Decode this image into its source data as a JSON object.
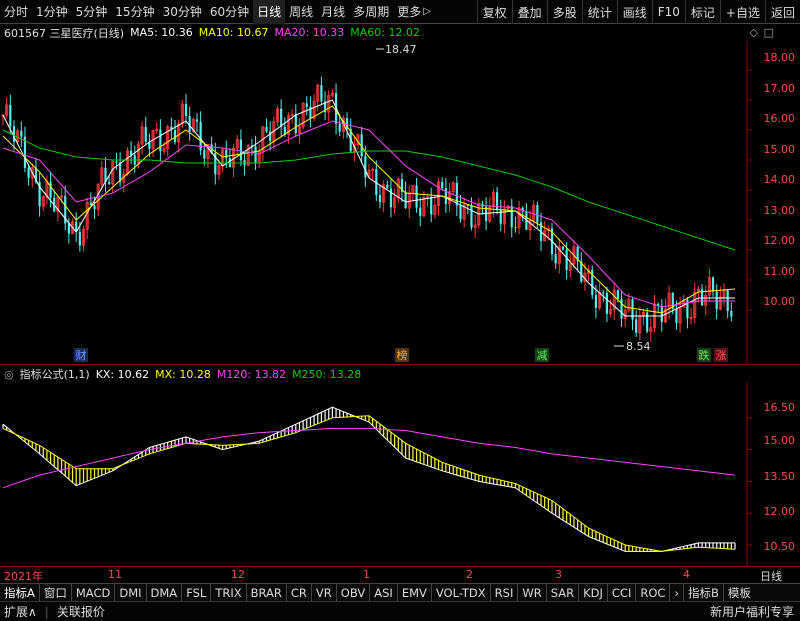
{
  "toolbar": {
    "periods": [
      "分时",
      "1分钟",
      "5分钟",
      "15分钟",
      "30分钟",
      "60分钟",
      "日线",
      "周线",
      "月线",
      "多周期",
      "更多"
    ],
    "more_arrow": "▷",
    "active_period": "日线",
    "actions": [
      "复权",
      "叠加",
      "多股",
      "统计",
      "画线",
      "F10",
      "标记",
      "+自选",
      "返回"
    ]
  },
  "main": {
    "stock": "601567 三星医疗(日线)",
    "ma5": "MA5: 10.36",
    "ma10": "MA10: 10.67",
    "ma20": "MA20: 10.33",
    "ma60": "MA60: 12.02",
    "high_marker": "18.47",
    "low_marker": "8.54",
    "y_ticks": [
      "18.00",
      "17.00",
      "16.00",
      "15.00",
      "14.00",
      "13.00",
      "12.00",
      "11.00",
      "10.00"
    ],
    "event_tags": [
      "财",
      "榜",
      "减",
      "跌",
      "涨"
    ]
  },
  "sub": {
    "title": "指标公式(1,1)",
    "kx": "KX: 10.62",
    "mx": "MX: 10.28",
    "m120": "M120: 13.82",
    "m250": "M250: 13.28",
    "y_ticks": [
      "16.50",
      "15.00",
      "13.50",
      "12.00",
      "10.50"
    ]
  },
  "dates": {
    "labels": [
      "2021年",
      "11",
      "12",
      "1",
      "2",
      "3",
      "4"
    ],
    "right": "日线"
  },
  "tabs": [
    "指标A",
    "窗口",
    "MACD",
    "DMI",
    "DMA",
    "FSL",
    "TRIX",
    "BRAR",
    "CR",
    "VR",
    "OBV",
    "ASI",
    "EMV",
    "VOL-TDX",
    "RSI",
    "WR",
    "SAR",
    "KDJ",
    "CCI",
    "ROC",
    "›",
    "指标B",
    "模板"
  ],
  "bottom": {
    "left": [
      "扩展∧",
      "关联报价"
    ],
    "right": "新用户福利专享"
  },
  "colors": {
    "up": "#ff3b3b",
    "down": "#54f0f0",
    "ma5": "#ffffff",
    "ma10": "#ffff00",
    "ma20": "#ff44ff",
    "ma60": "#00cc00",
    "axis": "#8b0000",
    "price": "#ff4a4a"
  },
  "chart_data": [
    {
      "type": "line",
      "title": "601567 三星医疗(日线)",
      "ylim": [
        8.3,
        18.9
      ],
      "series": [
        {
          "name": "MA5",
          "x": [
            0,
            10,
            20,
            30,
            40,
            50,
            60,
            70,
            80,
            90,
            100,
            110,
            120,
            130,
            140,
            150,
            160,
            170,
            180,
            190,
            200
          ],
          "values": [
            16.5,
            14.1,
            12.6,
            14.7,
            15.6,
            16.3,
            14.8,
            15.6,
            16.5,
            17.0,
            14.4,
            13.6,
            13.8,
            13.2,
            13.3,
            12.3,
            10.9,
            9.8,
            9.8,
            10.4,
            10.4
          ]
        },
        {
          "name": "MA10",
          "x": [
            0,
            10,
            20,
            30,
            40,
            50,
            60,
            70,
            80,
            90,
            100,
            110,
            120,
            130,
            140,
            150,
            160,
            170,
            180,
            190,
            200
          ],
          "values": [
            15.8,
            14.6,
            13.0,
            14.1,
            15.2,
            16.0,
            15.1,
            15.3,
            16.1,
            16.8,
            15.1,
            13.9,
            13.8,
            13.4,
            13.3,
            12.6,
            11.3,
            10.1,
            9.9,
            10.6,
            10.7
          ]
        },
        {
          "name": "MA20",
          "x": [
            0,
            10,
            20,
            30,
            40,
            50,
            60,
            70,
            80,
            90,
            100,
            110,
            120,
            130,
            140,
            150,
            160,
            170,
            180,
            190,
            200
          ],
          "values": [
            15.4,
            15.0,
            13.6,
            13.9,
            14.6,
            15.5,
            15.4,
            15.2,
            15.8,
            16.3,
            16.0,
            14.8,
            14.0,
            13.5,
            13.4,
            13.0,
            11.8,
            10.5,
            10.1,
            10.3,
            10.3
          ]
        },
        {
          "name": "MA60",
          "x": [
            0,
            10,
            20,
            30,
            40,
            50,
            60,
            70,
            80,
            90,
            100,
            110,
            120,
            130,
            140,
            150,
            160,
            170,
            180,
            190,
            200
          ],
          "values": [
            16.0,
            15.4,
            15.1,
            15.0,
            15.0,
            14.9,
            14.9,
            14.9,
            15.0,
            15.2,
            15.3,
            15.3,
            15.1,
            14.8,
            14.5,
            14.1,
            13.6,
            13.2,
            12.8,
            12.4,
            12.0
          ]
        }
      ]
    },
    {
      "type": "area",
      "title": "指标公式(1,1)",
      "ylim": [
        9.7,
        18.0
      ],
      "series": [
        {
          "name": "KX",
          "x": [
            0,
            10,
            20,
            30,
            40,
            50,
            60,
            70,
            80,
            90,
            100,
            110,
            120,
            130,
            140,
            150,
            160,
            170,
            180,
            190,
            200
          ],
          "values": [
            16.2,
            14.8,
            13.3,
            14.0,
            15.1,
            15.6,
            15.0,
            15.4,
            16.2,
            17.0,
            16.3,
            14.6,
            14.0,
            13.5,
            13.2,
            12.0,
            10.9,
            10.2,
            10.2,
            10.6,
            10.6
          ]
        },
        {
          "name": "MX",
          "x": [
            0,
            10,
            20,
            30,
            40,
            50,
            60,
            70,
            80,
            90,
            100,
            110,
            120,
            130,
            140,
            150,
            160,
            170,
            180,
            190,
            200
          ],
          "values": [
            16.0,
            15.2,
            14.1,
            14.1,
            14.8,
            15.3,
            15.2,
            15.3,
            15.8,
            16.5,
            16.6,
            15.3,
            14.4,
            13.8,
            13.4,
            12.6,
            11.3,
            10.5,
            10.2,
            10.4,
            10.3
          ]
        },
        {
          "name": "M120",
          "x": [
            0,
            10,
            20,
            30,
            40,
            50,
            60,
            70,
            80,
            90,
            100,
            110,
            120,
            130,
            140,
            150,
            160,
            170,
            180,
            190,
            200
          ],
          "values": [
            13.2,
            13.8,
            14.2,
            14.6,
            15.0,
            15.3,
            15.6,
            15.8,
            15.9,
            16.0,
            16.0,
            15.9,
            15.6,
            15.3,
            15.1,
            14.8,
            14.6,
            14.4,
            14.2,
            14.0,
            13.8
          ]
        }
      ]
    }
  ]
}
